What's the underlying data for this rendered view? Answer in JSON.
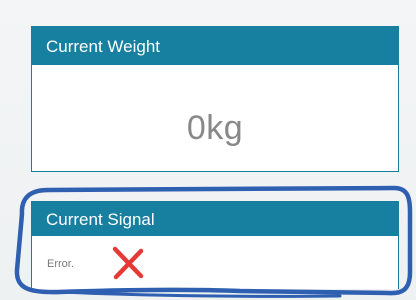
{
  "weight_card": {
    "title": "Current Weight",
    "value": "0kg"
  },
  "signal_card": {
    "title": "Current Signal",
    "status_text": "Error.",
    "status_icon": "red-x-icon"
  },
  "colors": {
    "header": "#177f9f",
    "annotation": "#2f5fb0",
    "error": "#e53935"
  }
}
